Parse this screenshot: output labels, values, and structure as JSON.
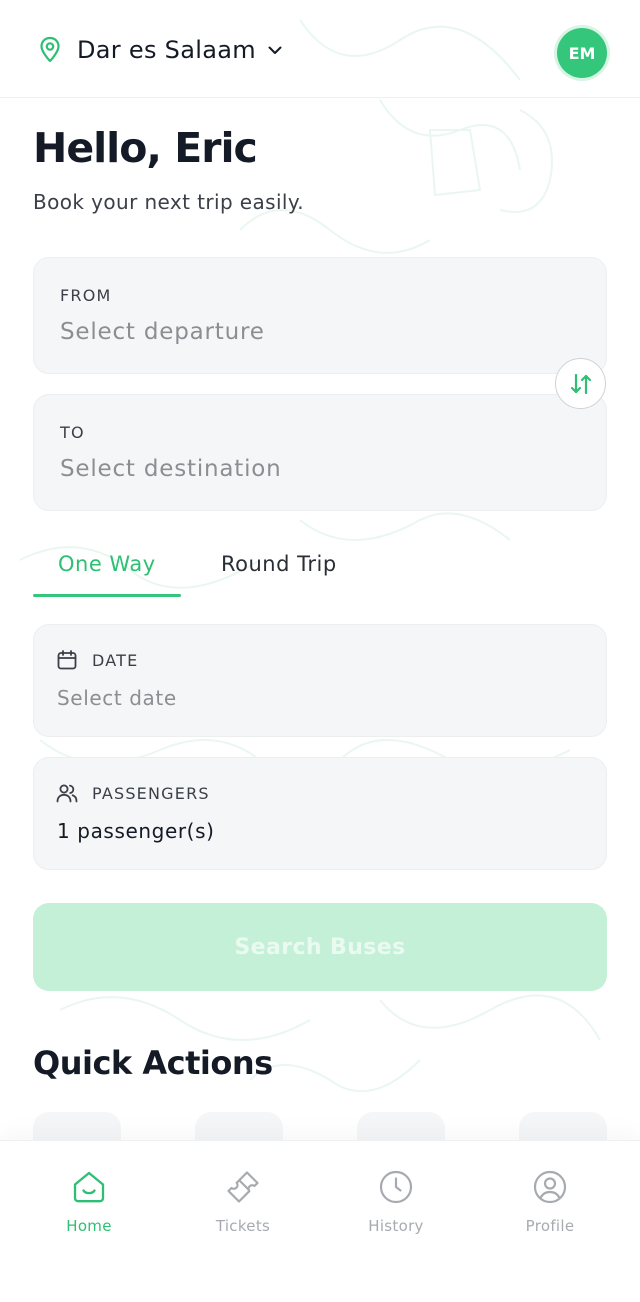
{
  "header": {
    "location": "Dar es Salaam",
    "avatar_initials": "EM"
  },
  "greeting": {
    "title": "Hello, Eric",
    "subtitle": "Book your next trip easily."
  },
  "from": {
    "label": "FROM",
    "placeholder": "Select departure"
  },
  "to": {
    "label": "TO",
    "placeholder": "Select destination"
  },
  "trip_tabs": {
    "one_way": "One Way",
    "round_trip": "Round Trip",
    "active": "one_way"
  },
  "date": {
    "label": "DATE",
    "placeholder": "Select date"
  },
  "passengers": {
    "label": "PASSENGERS",
    "value": "1 passenger(s)"
  },
  "search_button": "Search Buses",
  "quick_actions": {
    "title": "Quick Actions"
  },
  "bottom_nav": {
    "home": "Home",
    "tickets": "Tickets",
    "history": "History",
    "profile": "Profile",
    "active": "home"
  },
  "colors": {
    "accent": "#34c77b",
    "accent_text": "#2dbf73",
    "search_button_disabled": "#c3f0d7",
    "card_bg": "#f5f6f7",
    "text_primary": "#141a26",
    "text_muted": "#8b8e93"
  },
  "icons": {
    "location": "map-pin-icon",
    "dropdown": "chevron-down-icon",
    "swap": "swap-vertical-icon",
    "date": "calendar-icon",
    "passengers": "users-icon",
    "home": "home-icon",
    "tickets": "ticket-icon",
    "history": "clock-icon",
    "profile": "user-circle-icon"
  }
}
